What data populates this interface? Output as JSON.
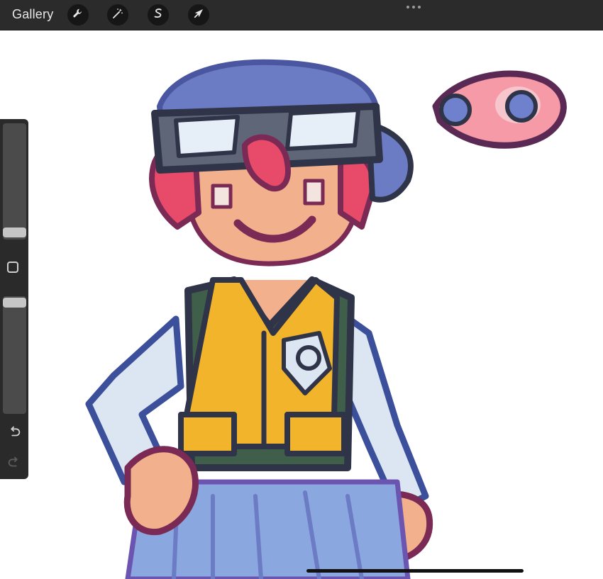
{
  "topbar": {
    "gallery_label": "Gallery",
    "tools": [
      {
        "name": "actions",
        "icon": "wrench-icon"
      },
      {
        "name": "adjustments",
        "icon": "magic-wand-icon"
      },
      {
        "name": "selection",
        "icon": "selection-s-icon"
      },
      {
        "name": "transform",
        "icon": "arrow-cursor-icon"
      }
    ],
    "more_icon": "more-dots-icon"
  },
  "sidebar": {
    "brush_size_level": 0.42,
    "opacity_level": 0.05,
    "modifier_icon": "square-modifier-icon",
    "undo_icon": "undo-icon",
    "redo_icon": "redo-icon",
    "redo_enabled": false
  },
  "canvas": {
    "content": "character-drawing",
    "colors": {
      "outline": "#2f3448",
      "hat": "#6b7bc4",
      "hair": "#e84a6a",
      "skin": "#f3b08c",
      "vest_green": "#3f5f4a",
      "vest_yellow": "#f2b42a",
      "sleeve": "#dbe6f2",
      "pants": "#8aa7e0",
      "eye_creature": "#f59aa6"
    }
  }
}
